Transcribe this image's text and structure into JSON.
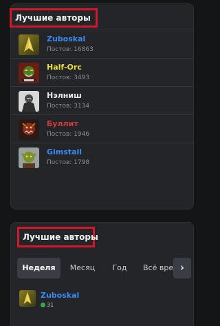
{
  "top_authors_card": {
    "title": "Лучшие авторы",
    "authors": [
      {
        "name": "Zuboskal",
        "name_color": "#3b8af3",
        "posts": "Постов: 16863",
        "avatar_icon": "sword-warrior-avatar-icon"
      },
      {
        "name": "Half-Orc",
        "name_color": "#e8df3a",
        "posts": "Постов: 3493",
        "avatar_icon": "orc-warrior-avatar-icon"
      },
      {
        "name": "Нэлниш",
        "name_color": "#e8e8e8",
        "posts": "Постов: 3134",
        "avatar_icon": "dark-knight-avatar-icon"
      },
      {
        "name": "Буллит",
        "name_color": "#d63b37",
        "posts": "Постов: 1946",
        "avatar_icon": "red-creature-avatar-icon"
      },
      {
        "name": "Gimstail",
        "name_color": "#3b8af3",
        "posts": "Постов: 1798",
        "avatar_icon": "goblin-avatar-icon"
      }
    ]
  },
  "top_authors_widget": {
    "title": "Лучшие авторы",
    "tabs": [
      "Неделя",
      "Месяц",
      "Год",
      "Всё время"
    ],
    "active_tab": "Неделя",
    "next_label": "›",
    "entry": {
      "name": "Zuboskal",
      "name_color": "#3b8af3",
      "reputation": "31",
      "avatar_icon": "sword-warrior-avatar-icon"
    }
  },
  "colors": {
    "highlight_box": "#d3182d",
    "background": "#141517",
    "card": "#232529"
  }
}
